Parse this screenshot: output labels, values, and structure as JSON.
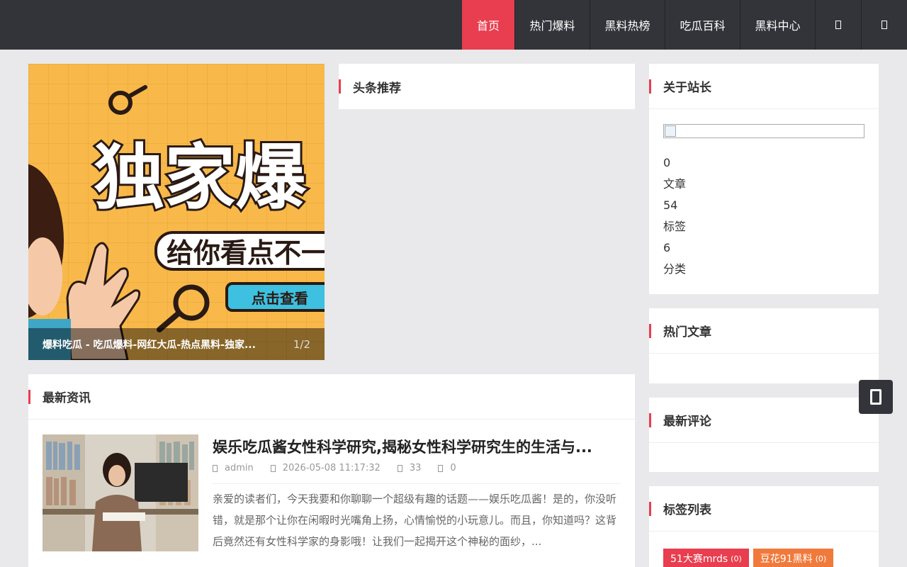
{
  "nav": {
    "items": [
      {
        "label": "首页",
        "active": true
      },
      {
        "label": "热门爆料"
      },
      {
        "label": "黑料热榜"
      },
      {
        "label": "吃瓜百科"
      },
      {
        "label": "黑料中心"
      }
    ],
    "icon_buttons": [
      "search-icon",
      "user-icon"
    ]
  },
  "slider": {
    "title": "爆料吃瓜 - 吃瓜爆料-网红大瓜-热点黑料-独家...",
    "counter": "1/2",
    "image_text": {
      "big": "独家爆",
      "sub": "给你看点不一",
      "button": "点击查看"
    }
  },
  "headline": {
    "title": "头条推荐"
  },
  "news": {
    "title": "最新资讯",
    "items": [
      {
        "title": "娱乐吃瓜酱女性科学研究,揭秘女性科学研究生的生活与...",
        "author": "admin",
        "date": "2026-05-08 11:17:32",
        "views": "33",
        "comments": "0",
        "excerpt": "亲爱的读者们，今天我要和你聊聊一个超级有趣的话题——娱乐吃瓜酱！是的，你没听错，就是那个让你在闲暇时光嘴角上扬，心情愉悦的小玩意儿。而且，你知道吗？这背后竟然还有女性科学家的身影哦！让我们一起揭开这个神秘的面纱，..."
      }
    ]
  },
  "about": {
    "title": "关于站长",
    "stats": [
      {
        "value": "0",
        "label": "文章"
      },
      {
        "value": "54",
        "label": "标签"
      },
      {
        "value": "6",
        "label": "分类"
      }
    ]
  },
  "hot": {
    "title": "热门文章"
  },
  "comments": {
    "title": "最新评论"
  },
  "tags": {
    "title": "标签列表",
    "items": [
      {
        "label": "51大赛mrds",
        "count": "(0)",
        "color": "#e83e4f"
      },
      {
        "label": "豆花91黑料",
        "count": "(0)",
        "color": "#f07a3c"
      }
    ]
  },
  "colors": {
    "accent": "#e83e4f",
    "nav_bg": "#333439",
    "page_bg": "#e9e9ec"
  }
}
